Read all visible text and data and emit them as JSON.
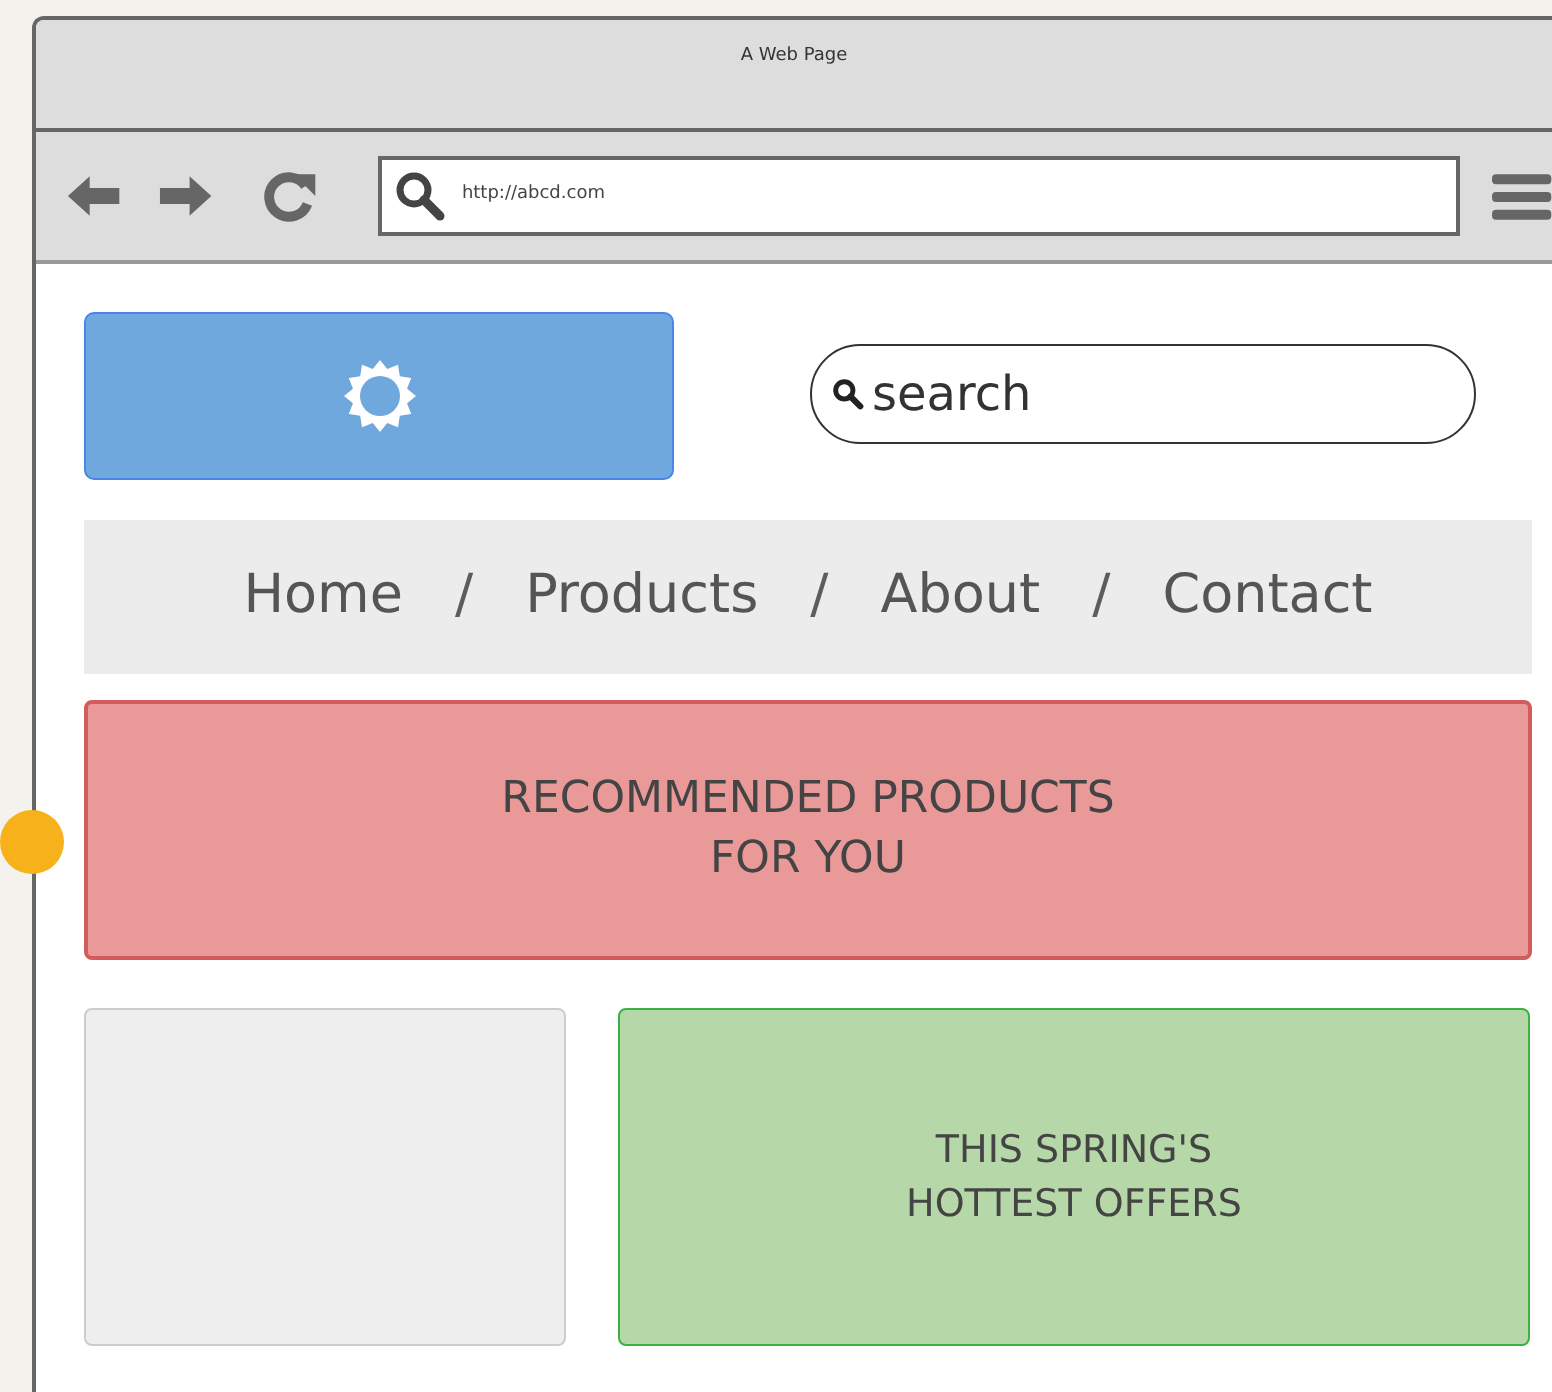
{
  "window": {
    "title": "A Web Page"
  },
  "toolbar": {
    "url": "http://abcd.com"
  },
  "header": {
    "search": {
      "placeholder": "search"
    }
  },
  "nav": [
    {
      "kind": "link",
      "label": "Home"
    },
    {
      "kind": "separator",
      "label": "/"
    },
    {
      "kind": "link",
      "label": "Products"
    },
    {
      "kind": "separator",
      "label": "/"
    },
    {
      "kind": "link",
      "label": "About"
    },
    {
      "kind": "separator",
      "label": "/"
    },
    {
      "kind": "link",
      "label": "Contact"
    }
  ],
  "banner": {
    "lines": [
      "RECOMMENDED PRODUCTS",
      "FOR YOU"
    ]
  },
  "offers": {
    "lines": [
      "THIS SPRING'S",
      "HOTTEST OFFERS"
    ]
  }
}
